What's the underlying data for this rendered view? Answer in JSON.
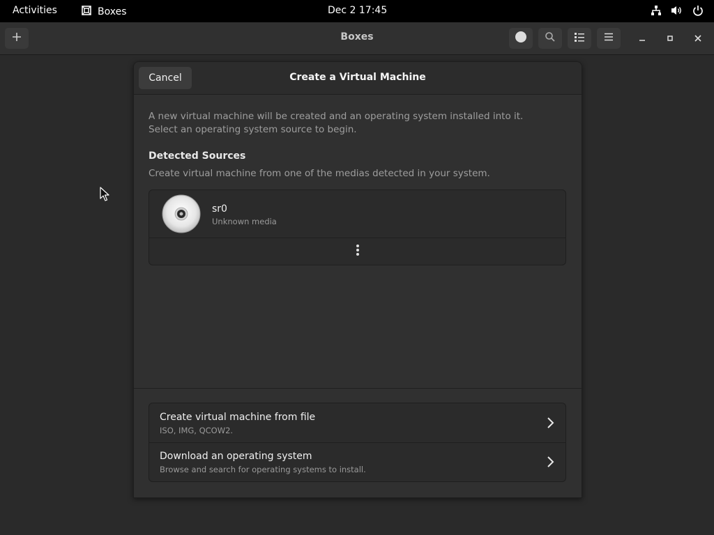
{
  "topbar": {
    "activities": "Activities",
    "app_name": "Boxes",
    "clock": "Dec 2  17:45",
    "tray_icons": [
      "network-icon",
      "volume-icon",
      "power-icon"
    ]
  },
  "window": {
    "title": "Boxes",
    "header_buttons": [
      "add-icon",
      "record-icon",
      "search-icon",
      "list-view-icon",
      "menu-icon"
    ],
    "wm_buttons": [
      "minimize-icon",
      "maximize-icon",
      "close-icon"
    ]
  },
  "dialog": {
    "title": "Create a Virtual Machine",
    "cancel_label": "Cancel",
    "intro_line1": "A new virtual machine will be created and an operating system installed into it.",
    "intro_line2": "Select an operating system source to begin.",
    "detected_title": "Detected Sources",
    "detected_subtitle": "Create virtual machine from one of the medias detected in your system.",
    "sources": [
      {
        "name": "sr0",
        "description": "Unknown media",
        "icon": "optical-disc-icon"
      }
    ],
    "actions": [
      {
        "title": "Create virtual machine from file",
        "subtitle": "ISO, IMG, QCOW2."
      },
      {
        "title": "Download an operating system",
        "subtitle": "Browse and search for operating systems to install."
      }
    ]
  },
  "colors": {
    "topbar_bg": "#000000",
    "window_bg": "#2a2a2a",
    "dialog_bg": "#303030",
    "list_bg": "#2b2b2b",
    "secondary_text": "#9e9e9e"
  }
}
